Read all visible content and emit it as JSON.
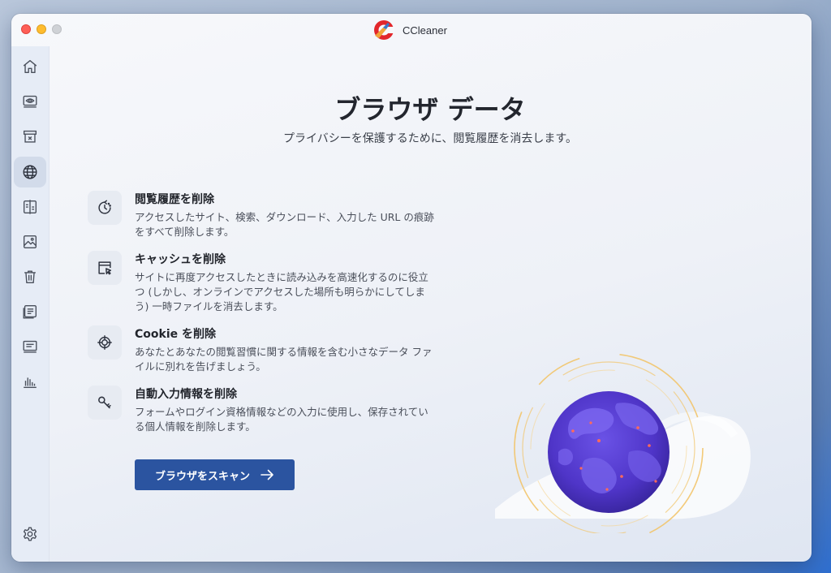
{
  "app": {
    "title": "CCleaner"
  },
  "sidebar": {
    "items": [
      {
        "name": "home",
        "icon": "home-icon",
        "active": false
      },
      {
        "name": "health-check",
        "icon": "eye-device-icon",
        "active": false
      },
      {
        "name": "app-cleaner",
        "icon": "archive-box-icon",
        "active": false
      },
      {
        "name": "browser-data",
        "icon": "globe-icon",
        "active": true
      },
      {
        "name": "duplicates",
        "icon": "compare-icon",
        "active": false
      },
      {
        "name": "similar-photos",
        "icon": "image-icon",
        "active": false
      },
      {
        "name": "trash",
        "icon": "trash-icon",
        "active": false
      },
      {
        "name": "large-files",
        "icon": "file-list-icon",
        "active": false
      },
      {
        "name": "startup",
        "icon": "display-list-icon",
        "active": false
      },
      {
        "name": "performance",
        "icon": "bar-chart-icon",
        "active": false
      }
    ],
    "settings_icon": "gear-icon"
  },
  "main": {
    "title": "ブラウザ データ",
    "subtitle": "プライバシーを保護するために、閲覧履歴を消去します。",
    "features": [
      {
        "icon": "history-clock-icon",
        "title": "閲覧履歴を削除",
        "description": "アクセスしたサイト、検索、ダウンロード、入力した URL の痕跡をすべて削除します。"
      },
      {
        "icon": "cache-window-icon",
        "title": "キャッシュを削除",
        "description": "サイトに再度アクセスしたときに読み込みを高速化するのに役立つ (しかし、オンラインでアクセスした場所も明らかにしてしまう) 一時ファイルを消去します。"
      },
      {
        "icon": "crosshair-icon",
        "title": "Cookie を削除",
        "description": "あなたとあなたの閲覧習慣に関する情報を含む小さなデータ ファイルに別れを告げましょう。"
      },
      {
        "icon": "key-icon",
        "title": "自動入力情報を削除",
        "description": "フォームやログイン資格情報などの入力に使用し、保存されている個人情報を削除します。"
      }
    ],
    "scan_button_label": "ブラウザをスキャン"
  },
  "colors": {
    "accent": "#2b54a0",
    "globe": "#5a3fd0",
    "orbit": "#f2c46a",
    "icon_stroke": "#4a505c"
  }
}
